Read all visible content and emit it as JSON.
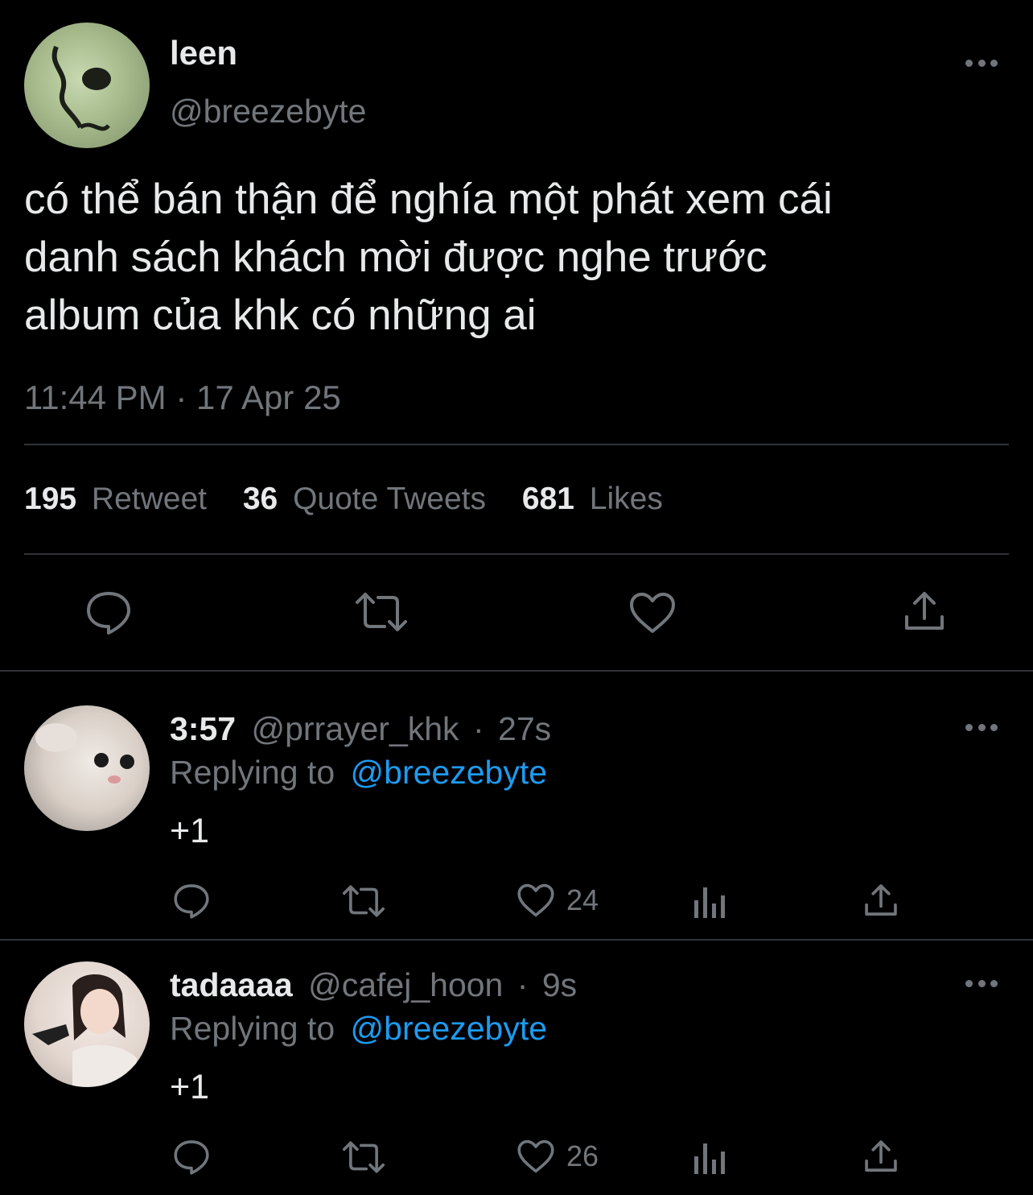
{
  "main_tweet": {
    "display_name": "leen",
    "handle": "@breezebyte",
    "text_lines": [
      "có thể bán thận để nghía một phát xem cái",
      "danh sách khách mời được nghe trước",
      "album của khk có những ai"
    ],
    "timestamp": "11:44 PM · 17 Apr 25",
    "stats": {
      "retweets": "195",
      "retweets_label": "Retweet",
      "quotes": "36",
      "quotes_label": "Quote Tweets",
      "likes": "681",
      "likes_label": "Likes"
    }
  },
  "replies": [
    {
      "display_name": "3:57",
      "handle": "@prrayer_khk",
      "time": "27s",
      "replying_label": "Replying to",
      "replying_to": "@breezebyte",
      "text": "+1",
      "likes": "24"
    },
    {
      "display_name": "tadaaaa",
      "handle": "@cafej_hoon",
      "time": "9s",
      "replying_label": "Replying to",
      "replying_to": "@breezebyte",
      "text": "+1",
      "likes": "26"
    }
  ],
  "colors": {
    "background": "#000000",
    "text": "#e7e9ea",
    "muted": "#71767b",
    "link": "#1d9bf0",
    "divider": "#2f3336"
  },
  "icons": {
    "reply": "speech-bubble-icon",
    "retweet": "retweet-arrows-icon",
    "like": "heart-icon",
    "share": "share-upload-icon",
    "views": "bar-chart-icon",
    "more": "more-dots-icon"
  },
  "sep": "·"
}
